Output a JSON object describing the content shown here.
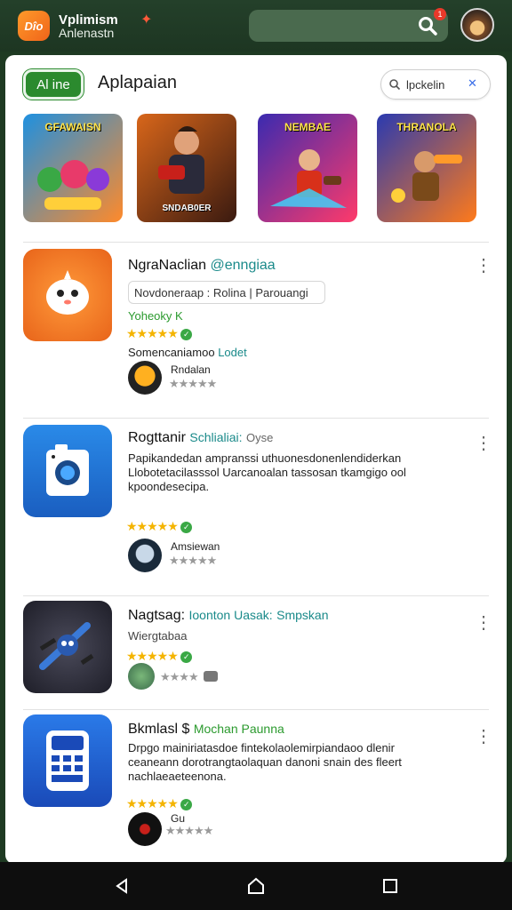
{
  "header": {
    "logo_text": "Dîo",
    "app_name": "Vplimism",
    "app_subtitle": "Anlenastn",
    "notification_count": "1"
  },
  "section": {
    "chip_label": "Al ine",
    "title": "Aplapaian",
    "search_text": "lpckelin"
  },
  "featured": [
    {
      "label": "GFAWAISN",
      "sublabel": "",
      "colors": [
        "#1e90e0",
        "#ff8a2a"
      ]
    },
    {
      "label": "",
      "sublabel": "SNDAB0ER",
      "colors": [
        "#d8661a",
        "#3a1a10"
      ]
    },
    {
      "label": "NEMBAE",
      "sublabel": "",
      "colors": [
        "#3a2ab0",
        "#ff3a6a"
      ]
    },
    {
      "label": "THRANOLA",
      "sublabel": "",
      "colors": [
        "#2a3ab0",
        "#ff7a1a"
      ]
    }
  ],
  "apps": [
    {
      "title": "NgraNaclian",
      "title_accent": "@enngiaa",
      "tags": "Novdoneraap : Rolina | Parouangi",
      "rating_text": "Yoheoky K",
      "subtitle": "Somencaniamoo",
      "subtitle_accent": "Lodet",
      "reviewer": "Rndalan",
      "icon_color": "#f2841e"
    },
    {
      "title": "Rogttanir",
      "title_accent": "Schlialiai:",
      "title_tail": "Oyse",
      "description": "Papikandedan ampranssi uthuonesdonenlendiderkan Llobotetacilasssol Uarcanoalan tassosan tkamgigo ool kpoondesecipa.",
      "reviewer": "Amsiewan",
      "icon_color": "#1e6ed0"
    },
    {
      "title": "Nagtsag:",
      "title_accent": "Ioonton Uasak:",
      "title_tail": "Smpskan",
      "subtitle": "Wiergtabaa",
      "icon_color": "#3a3a4a"
    },
    {
      "title": "Bkmlasl $",
      "title_accent": "Mochan Paunna",
      "description": "Drpgo mainiriatasdoe fintekolaolemirpiandaoo dlenir ceaneann dorotrangtaolaquan danoni snain des fleert nachlaeaeteenona.",
      "reviewer": "Gu",
      "icon_color": "#1e5ec8"
    }
  ],
  "colors": {
    "header_bg": "#1e3a22",
    "brand_green": "#2b8a2e",
    "accent_teal": "#1a8a8a",
    "star": "#f4b400"
  }
}
